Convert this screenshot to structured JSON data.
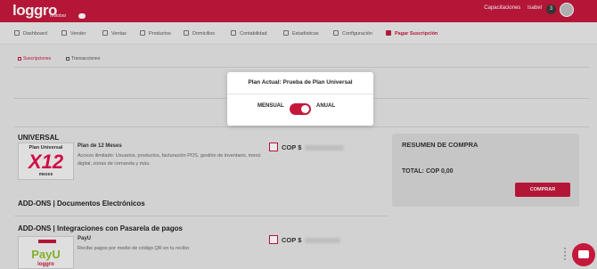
{
  "brand": {
    "name": "loggro",
    "sub": "restobar"
  },
  "topbar": {
    "company": "Capacitaciones",
    "user": "Isabel",
    "badge": "3",
    "accent": "#c4183c"
  },
  "nav": [
    {
      "label": "Dashboard",
      "icon": "dashboard-icon"
    },
    {
      "label": "Vender",
      "icon": "vender-icon"
    },
    {
      "label": "Ventas",
      "icon": "tag-icon"
    },
    {
      "label": "Productos",
      "icon": "box-icon"
    },
    {
      "label": "Domicilios",
      "icon": "bike-icon"
    },
    {
      "label": "Contabilidad",
      "icon": "calculator-icon"
    },
    {
      "label": "Estadísticas",
      "icon": "chart-icon"
    },
    {
      "label": "Configuración",
      "icon": "gear-icon"
    },
    {
      "label": "Pagar Suscripción",
      "icon": "card-icon"
    }
  ],
  "tabs": {
    "subscriptions": "Suscripciones",
    "transactions": "Transacciones"
  },
  "universal": {
    "title": "UNIVERSAL",
    "card_top": "Plan Universal",
    "card_big": "X12",
    "card_bottom": "meses",
    "plan_name": "Plan de 12 Meses",
    "description": "Acceso ilimitado: Usuarios, productos, facturación POS, gestión de inventario, menú digital, zonas de comanda y más.",
    "price_prefix": "COP $"
  },
  "addons_docs": {
    "title": "ADD-ONS | Documentos Electrónicos"
  },
  "addons_pay": {
    "title": "ADD-ONS | Integraciones con Pasarela de pagos",
    "name": "PayU",
    "description": "Recibe pagos por medio de código QR en tu recibo",
    "price_prefix": "COP $",
    "logo_text": "PayU",
    "logo_sub": "loggro"
  },
  "summary": {
    "title": "RESUMEN DE COMPRA",
    "total": "TOTAL: COP 0,00",
    "button": "COMPRAR"
  },
  "modal": {
    "title": "Plan Actual: Prueba de Plan Universal",
    "monthly": "MENSUAL",
    "annual": "ANUAL",
    "annual_selected": true
  }
}
